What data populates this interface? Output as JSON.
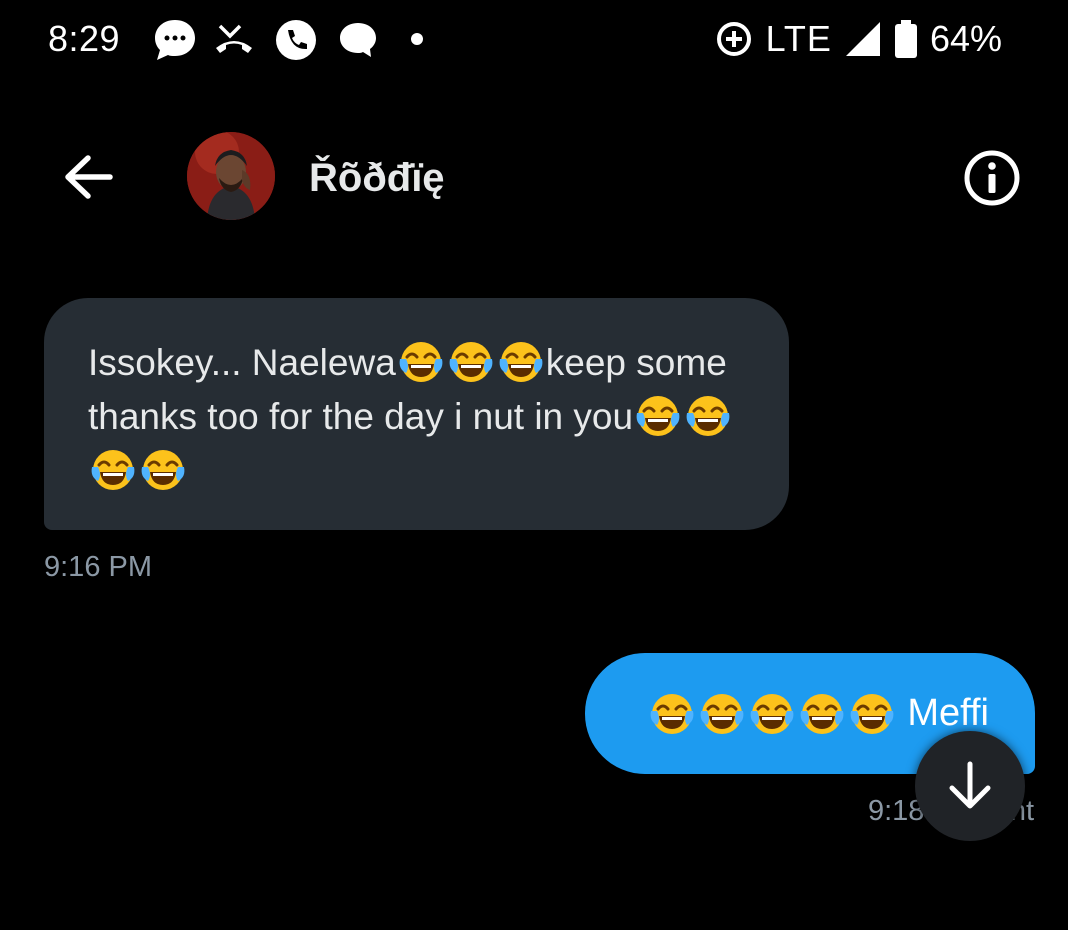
{
  "status_bar": {
    "time": "8:29",
    "network": "LTE",
    "battery": "64%",
    "icons": [
      "chat-bubble-icon",
      "missed-call-icon",
      "phone-icon",
      "message-icon",
      "dot-icon",
      "data-saver-icon",
      "signal-icon",
      "battery-icon"
    ]
  },
  "header": {
    "back_icon": "arrow-left-icon",
    "contact_name": "Řõðđïę",
    "info_icon": "info-icon"
  },
  "messages": [
    {
      "direction": "incoming",
      "parts": [
        "Issokey... Naelewa",
        "keep some thanks too for the day i nut in you"
      ],
      "emoji": "face-with-tears-of-joy",
      "timestamp": "9:16 PM"
    },
    {
      "direction": "outgoing",
      "text": "Meffi",
      "emoji": "face-with-tears-of-joy",
      "emoji_count": 5,
      "timestamp": "9:18 P",
      "timestamp_suffix": "nt"
    }
  ],
  "scroll_button": {
    "icon": "arrow-down-icon"
  },
  "colors": {
    "background": "#000000",
    "incoming_bubble": "#262d34",
    "outgoing_bubble": "#1d9bf0",
    "timestamp": "#8b98a5"
  }
}
